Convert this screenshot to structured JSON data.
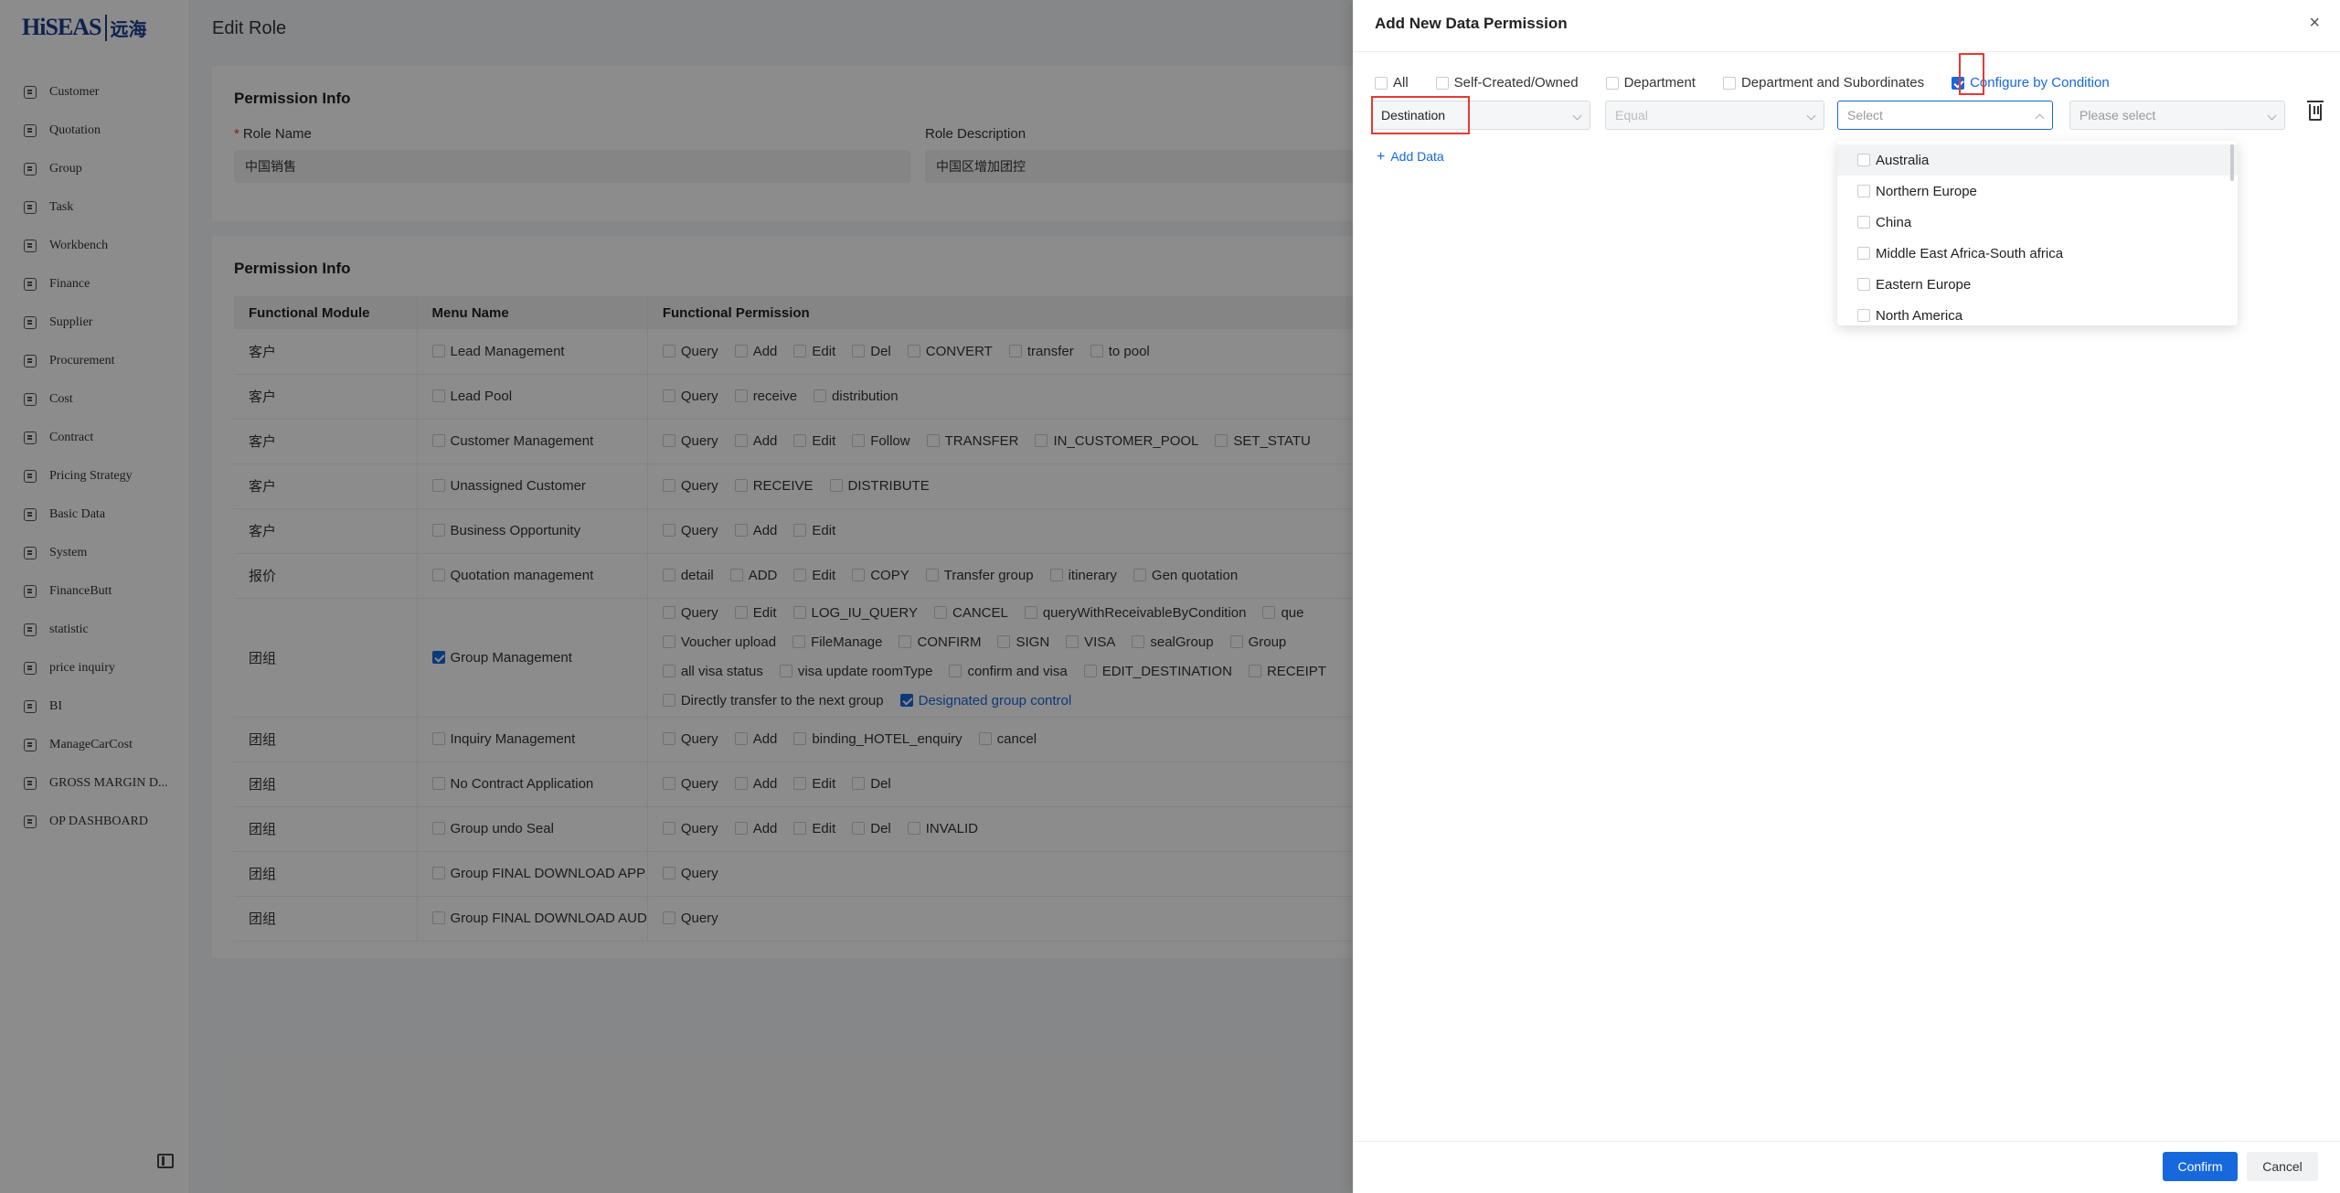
{
  "logo": {
    "text": "HiSEAS",
    "cn": "远海"
  },
  "sidebar": {
    "items": [
      {
        "label": "Customer"
      },
      {
        "label": "Quotation"
      },
      {
        "label": "Group"
      },
      {
        "label": "Task"
      },
      {
        "label": "Workbench"
      },
      {
        "label": "Finance"
      },
      {
        "label": "Supplier"
      },
      {
        "label": "Procurement"
      },
      {
        "label": "Cost"
      },
      {
        "label": "Contract"
      },
      {
        "label": "Pricing Strategy"
      },
      {
        "label": "Basic Data"
      },
      {
        "label": "System"
      },
      {
        "label": "FinanceButt"
      },
      {
        "label": "statistic"
      },
      {
        "label": "price inquiry"
      },
      {
        "label": "BI"
      },
      {
        "label": "ManageCarCost"
      },
      {
        "label": "GROSS MARGIN D..."
      },
      {
        "label": "OP DASHBOARD"
      }
    ]
  },
  "page": {
    "title": "Edit Role"
  },
  "info_card": {
    "title": "Permission Info",
    "role_name_label": "Role Name",
    "role_name_value": "中国销售",
    "role_desc_label": "Role Description",
    "role_desc_value": "中国区增加团控"
  },
  "perm_card": {
    "title": "Permission Info",
    "headers": [
      "Functional Module",
      "Menu Name",
      "Functional Permission"
    ],
    "rows": [
      {
        "module": "客户",
        "menu": "Lead Management",
        "lines": [
          [
            "Query",
            "Add",
            "Edit",
            "Del",
            "CONVERT",
            "transfer",
            "to pool"
          ]
        ]
      },
      {
        "module": "客户",
        "menu": "Lead Pool",
        "lines": [
          [
            "Query",
            "receive",
            "distribution"
          ]
        ]
      },
      {
        "module": "客户",
        "menu": "Customer Management",
        "lines": [
          [
            "Query",
            "Add",
            "Edit",
            "Follow",
            "TRANSFER",
            "IN_CUSTOMER_POOL",
            "SET_STATU"
          ]
        ]
      },
      {
        "module": "客户",
        "menu": "Unassigned Customer",
        "lines": [
          [
            "Query",
            "RECEIVE",
            "DISTRIBUTE"
          ]
        ]
      },
      {
        "module": "客户",
        "menu": "Business Opportunity",
        "lines": [
          [
            "Query",
            "Add",
            "Edit"
          ]
        ]
      },
      {
        "module": "报价",
        "menu": "Quotation management",
        "lines": [
          [
            "detail",
            "ADD",
            "Edit",
            "COPY",
            "Transfer group",
            "itinerary",
            "Gen quotation"
          ]
        ]
      },
      {
        "module": "团组",
        "menu": "Group Management",
        "lines": [
          [
            "Query",
            "Edit",
            "LOG_IU_QUERY",
            "CANCEL",
            "queryWithReceivableByCondition",
            "que"
          ],
          [
            "Voucher upload",
            "FileManage",
            "CONFIRM",
            "SIGN",
            "VISA",
            "sealGroup",
            "Group"
          ],
          [
            "all visa status",
            "visa update roomType",
            "confirm and visa",
            "EDIT_DESTINATION",
            "RECEIPT"
          ],
          [
            "Directly transfer to the next group",
            "Designated group control"
          ]
        ]
      },
      {
        "module": "团组",
        "menu": "Inquiry Management",
        "lines": [
          [
            "Query",
            "Add",
            "binding_HOTEL_enquiry",
            "cancel"
          ]
        ]
      },
      {
        "module": "团组",
        "menu": "No Contract Application",
        "lines": [
          [
            "Query",
            "Add",
            "Edit",
            "Del"
          ]
        ]
      },
      {
        "module": "团组",
        "menu": "Group undo Seal",
        "lines": [
          [
            "Query",
            "Add",
            "Edit",
            "Del",
            "INVALID"
          ]
        ]
      },
      {
        "module": "团组",
        "menu": "Group FINAL DOWNLOAD APP",
        "lines": [
          [
            "Query"
          ]
        ]
      },
      {
        "module": "团组",
        "menu": "Group FINAL DOWNLOAD AUD",
        "lines": [
          [
            "Query"
          ]
        ]
      }
    ]
  },
  "drawer": {
    "title": "Add New Data Permission",
    "close": "×",
    "scopes": [
      "All",
      "Self-Created/Owned",
      "Department",
      "Department and Subordinates",
      "Configure by Condition"
    ],
    "field_value": "Destination",
    "operator_placeholder": "Equal",
    "value_placeholder": "Select",
    "value2_placeholder": "Please select",
    "add_data": "Add Data",
    "options": [
      "Australia",
      "Northern Europe",
      "China",
      "Middle East Africa-South africa",
      "Eastern Europe",
      "North America"
    ],
    "confirm": "Confirm",
    "cancel": "Cancel"
  },
  "colors": {
    "accent": "#1668dc",
    "highlight": "#e53935",
    "brand": "#1a3f8f"
  }
}
